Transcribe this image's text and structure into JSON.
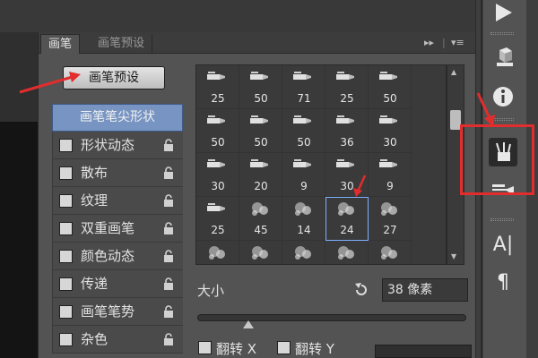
{
  "panel": {
    "tabs": [
      {
        "label": "画笔",
        "active": true
      },
      {
        "label": "画笔预设",
        "active": false
      }
    ],
    "controls": {
      "collapse": "▸▸",
      "menu": "▾≡"
    },
    "preset_button": "画笔预设",
    "tip_shape_label": "画笔笔尖形状",
    "options": [
      {
        "label": "形状动态",
        "checked": false,
        "locked": true
      },
      {
        "label": "散布",
        "checked": false,
        "locked": true
      },
      {
        "label": "纹理",
        "checked": false,
        "locked": true
      },
      {
        "label": "双重画笔",
        "checked": false,
        "locked": true
      },
      {
        "label": "颜色动态",
        "checked": false,
        "locked": true
      },
      {
        "label": "传递",
        "checked": false,
        "locked": true
      },
      {
        "label": "画笔笔势",
        "checked": false,
        "locked": true
      },
      {
        "label": "杂色",
        "checked": false,
        "locked": true
      }
    ],
    "brush_rows": [
      [
        "25",
        "50",
        "71",
        "25",
        "50"
      ],
      [
        "50",
        "50",
        "50",
        "36",
        "30"
      ],
      [
        "30",
        "20",
        "9",
        "30",
        "9"
      ],
      [
        "25",
        "45",
        "14",
        "24",
        "27"
      ],
      [
        "",
        "",
        "",
        "",
        ""
      ]
    ],
    "selected_brush": "24",
    "size_label": "大小",
    "size_value": "38 像素",
    "size_fraction": 0.19,
    "flip_x": "翻转 X",
    "flip_y": "翻转 Y"
  },
  "toolbar_icons": [
    "play-icon",
    "3d-cube-icon",
    "info-icon",
    "brush-icon",
    "brush-presets-icon",
    "character-icon",
    "paragraph-icon"
  ],
  "toolbar_text": {
    "character": "A|",
    "paragraph": "¶"
  },
  "annotation_color": "#e12d2d",
  "selection_color": "#7794c2"
}
